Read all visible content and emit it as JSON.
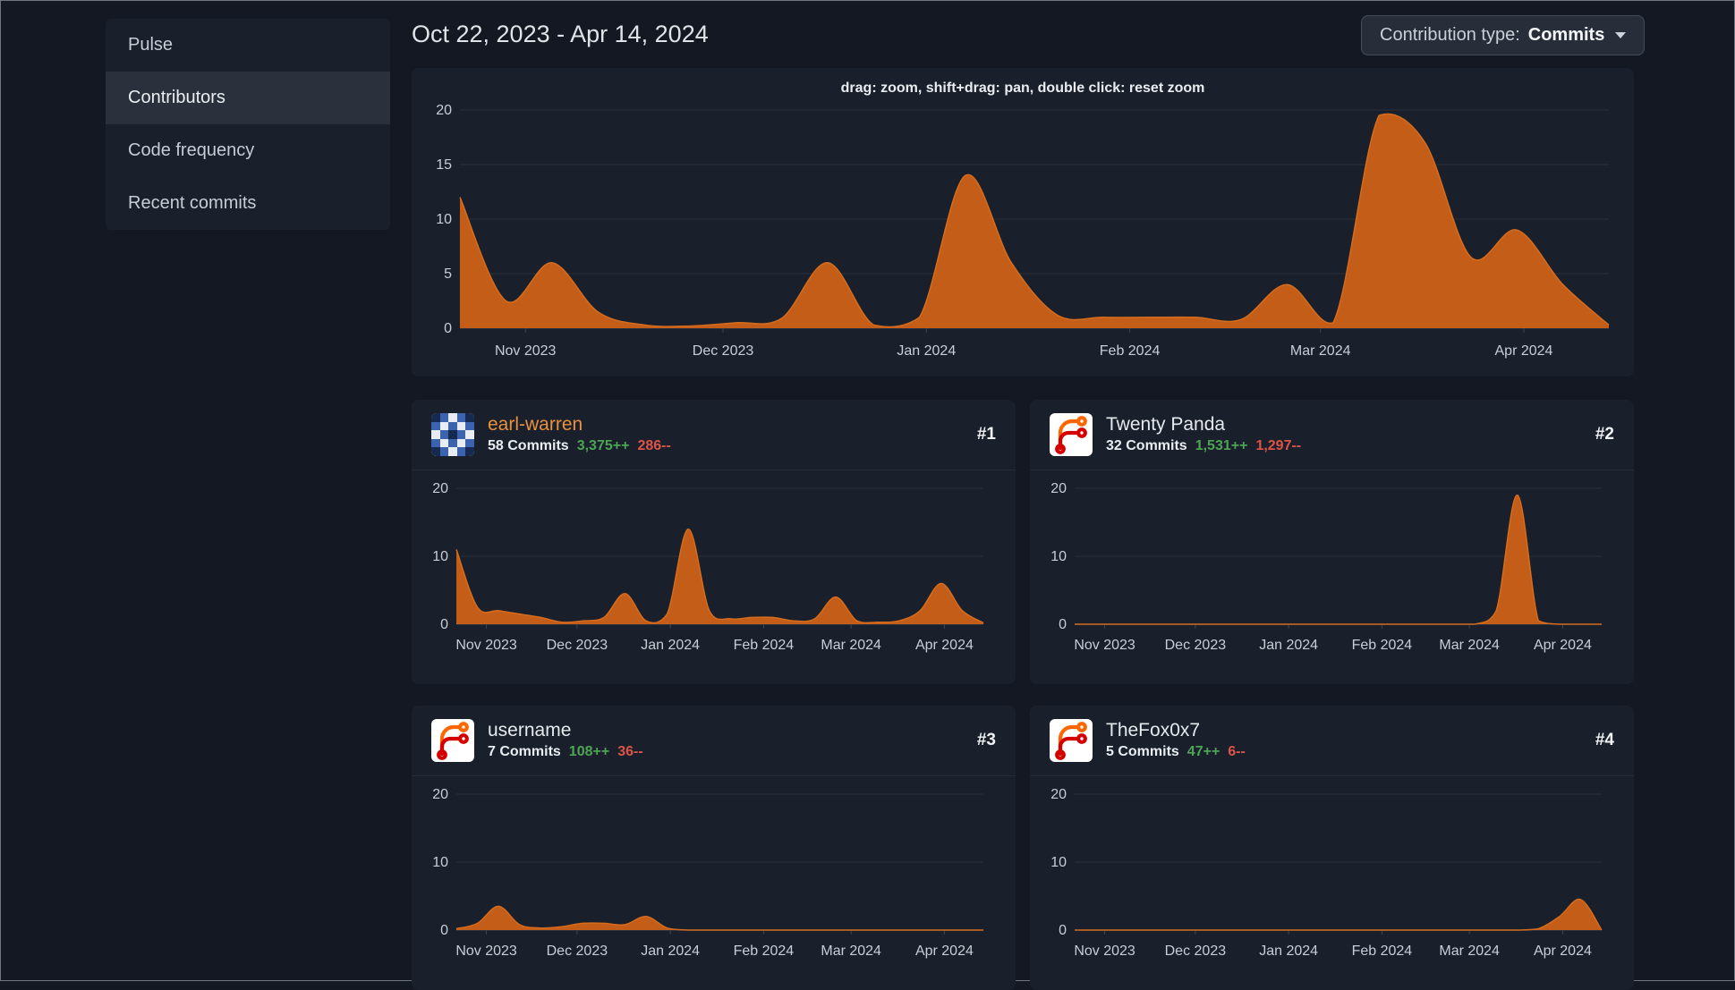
{
  "sidebar": {
    "items": [
      {
        "label": "Pulse",
        "active": false
      },
      {
        "label": "Contributors",
        "active": true
      },
      {
        "label": "Code frequency",
        "active": false
      },
      {
        "label": "Recent commits",
        "active": false
      }
    ]
  },
  "header": {
    "date_range": "Oct 22, 2023 - Apr 14, 2024",
    "contribution_type_label": "Contribution type:",
    "contribution_type_value": "Commits"
  },
  "main_chart": {
    "hint": "drag: zoom, shift+drag: pan, double click: reset zoom"
  },
  "contributors": [
    {
      "name": "earl-warren",
      "name_color": "#e8913d",
      "rank": "#1",
      "commits": "58 Commits",
      "additions": "3,375++",
      "deletions": "286--",
      "avatar": {
        "type": "identicon",
        "pixels": [
          "nbwbn",
          "bwbwb",
          "wbnbw",
          "bwbwb",
          "nbwbn"
        ],
        "palette": {
          "b": "#3b63b0",
          "w": "#e9edf3",
          "n": "#16294f"
        }
      }
    },
    {
      "name": "Twenty Panda",
      "name_color": "#e6eaee",
      "rank": "#2",
      "commits": "32 Commits",
      "additions": "1,531++",
      "deletions": "1,297--",
      "avatar": {
        "type": "forgejo-logo"
      }
    },
    {
      "name": "username",
      "name_color": "#e6eaee",
      "rank": "#3",
      "commits": "7 Commits",
      "additions": "108++",
      "deletions": "36--",
      "avatar": {
        "type": "forgejo-logo"
      }
    },
    {
      "name": "TheFox0x7",
      "name_color": "#e6eaee",
      "rank": "#4",
      "commits": "5 Commits",
      "additions": "47++",
      "deletions": "6--",
      "avatar": {
        "type": "forgejo-logo"
      }
    }
  ],
  "colors": {
    "page_bg": "#141822",
    "panel_bg": "#1a202b",
    "area_fill": "#c45d18",
    "area_stroke": "#d56c1e",
    "grid": "#2a303a",
    "grid_zero": "#3d444f",
    "axis_text": "#c7ced6",
    "additions_green": "#4da454",
    "deletions_red": "#dd5348",
    "logo_orange": "#ff6600",
    "logo_red": "#d40000"
  },
  "chart_data": {
    "type": "area",
    "x_range": [
      "Oct 22, 2023",
      "Apr 14, 2024"
    ],
    "x_interval": "weekly",
    "ylim": [
      0,
      20
    ],
    "xticks": [
      {
        "label": "Nov 2023",
        "frac": 0.057
      },
      {
        "label": "Dec 2023",
        "frac": 0.229
      },
      {
        "label": "Jan 2024",
        "frac": 0.406
      },
      {
        "label": "Feb 2024",
        "frac": 0.583
      },
      {
        "label": "Mar 2024",
        "frac": 0.749
      },
      {
        "label": "Apr 2024",
        "frac": 0.926
      }
    ],
    "charts": [
      {
        "id": "all-contributions",
        "yticks": [
          0,
          5,
          10,
          15,
          20
        ],
        "values": [
          12,
          2.5,
          6,
          1.5,
          0.3,
          0.2,
          0.5,
          0.9,
          6,
          0.3,
          1,
          14,
          6,
          1.2,
          1,
          1,
          1,
          0.8,
          4,
          0.5,
          19.5,
          17,
          6.5,
          9,
          4,
          0.3
        ]
      },
      {
        "id": "earl-warren",
        "yticks": [
          0,
          10,
          20
        ],
        "values": [
          11,
          2.5,
          2,
          1.5,
          1,
          0.3,
          0.5,
          1,
          4.5,
          0.5,
          1.5,
          14,
          2,
          0.8,
          1,
          1,
          0.5,
          0.8,
          4,
          0.5,
          0.3,
          0.5,
          2,
          6,
          2,
          0.2
        ]
      },
      {
        "id": "twenty-panda",
        "yticks": [
          0,
          10,
          20
        ],
        "values": [
          0,
          0,
          0,
          0,
          0,
          0,
          0,
          0,
          0,
          0,
          0,
          0,
          0,
          0,
          0,
          0,
          0,
          0,
          0,
          0,
          2,
          19,
          0.5,
          0,
          0,
          0
        ]
      },
      {
        "id": "username",
        "yticks": [
          0,
          10,
          20
        ],
        "values": [
          0.2,
          1,
          3.5,
          0.8,
          0.3,
          0.5,
          1,
          1,
          0.8,
          2,
          0.3,
          0,
          0,
          0,
          0,
          0,
          0,
          0,
          0,
          0,
          0,
          0,
          0,
          0,
          0,
          0
        ]
      },
      {
        "id": "thefox0x7",
        "yticks": [
          0,
          10,
          20
        ],
        "values": [
          0,
          0,
          0,
          0,
          0,
          0,
          0,
          0,
          0,
          0,
          0,
          0,
          0,
          0,
          0,
          0,
          0,
          0,
          0,
          0,
          0,
          0,
          0.2,
          2,
          4.5,
          0
        ]
      }
    ]
  }
}
